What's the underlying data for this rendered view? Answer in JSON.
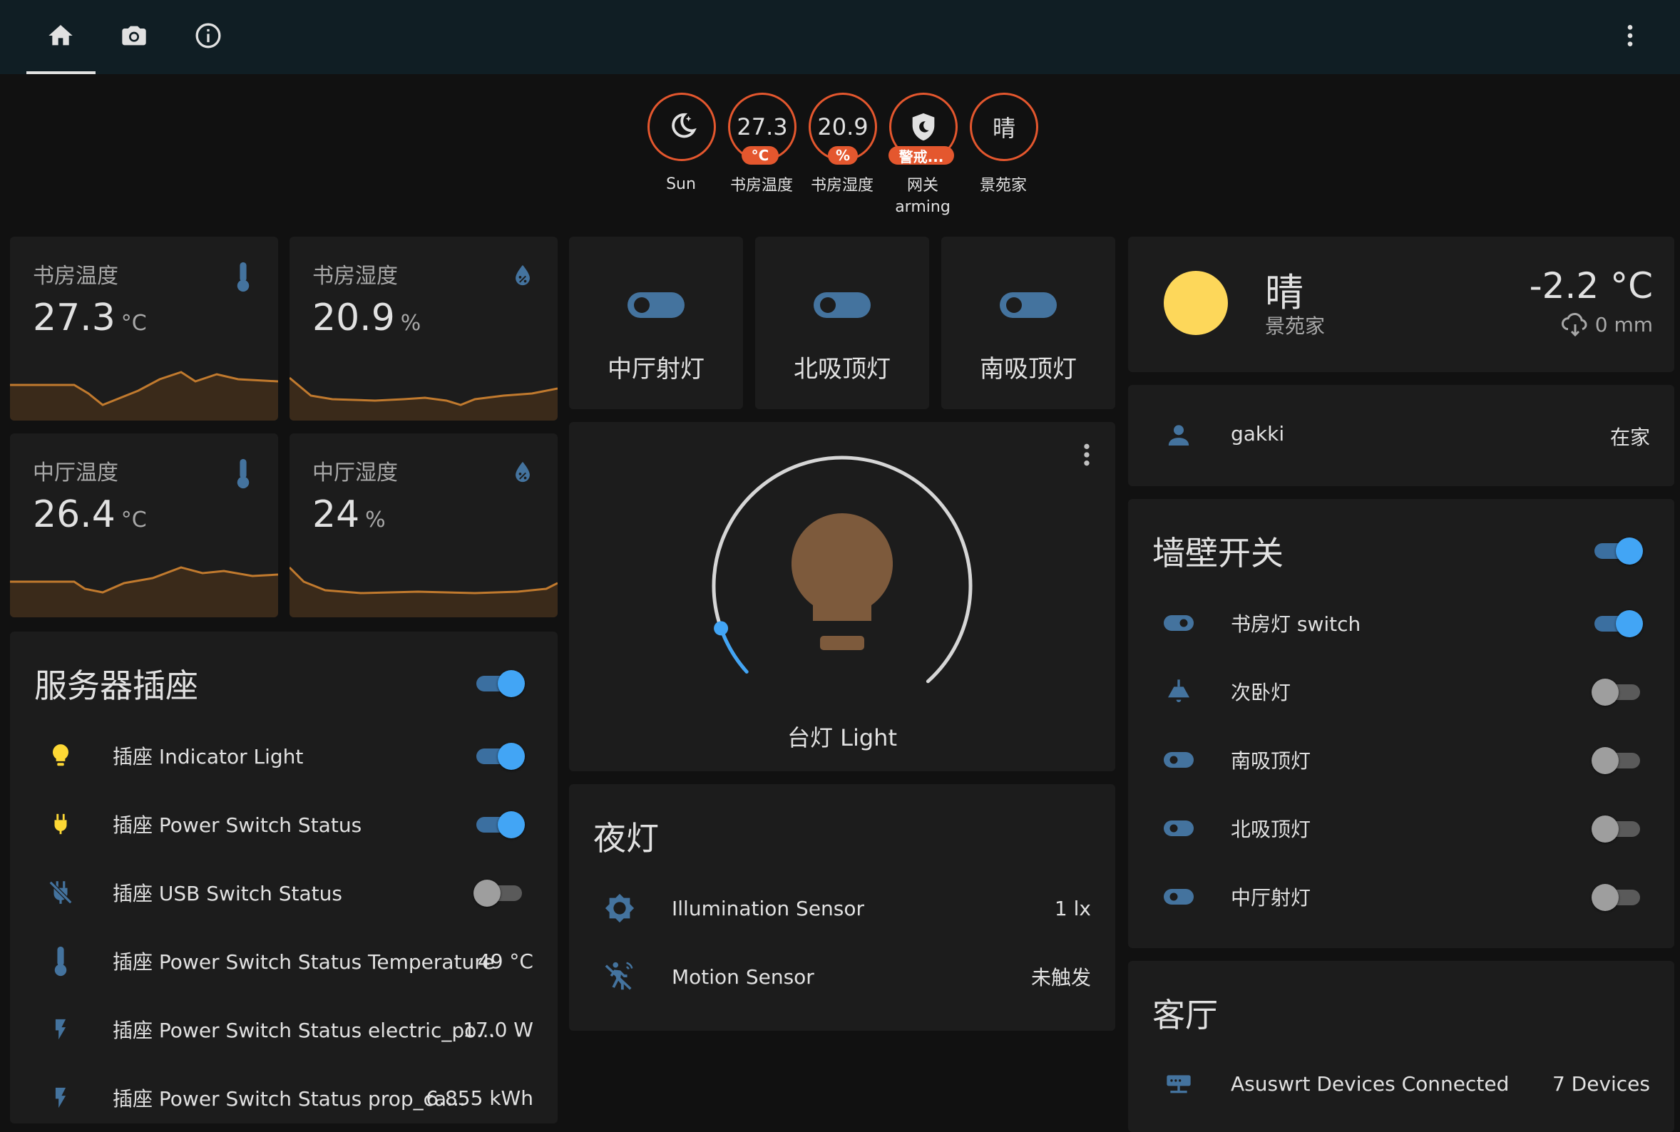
{
  "topbar": {
    "tabs": [
      {
        "icon": "home-icon",
        "active": true
      },
      {
        "icon": "camera-icon",
        "active": false
      },
      {
        "icon": "info-icon",
        "active": false
      }
    ],
    "menu_icon": "more-vertical-icon"
  },
  "badges": [
    {
      "icon": "weather-night-icon",
      "label": "Sun"
    },
    {
      "value": "27.3",
      "unit": "°C",
      "label": "书房温度"
    },
    {
      "value": "20.9",
      "unit": "%",
      "label": "书房湿度"
    },
    {
      "icon": "shield-moon-icon",
      "unit": "警戒...",
      "label": "网关",
      "label2": "arming"
    },
    {
      "value": "晴",
      "label": "景苑家"
    }
  ],
  "sensors": [
    {
      "name": "书房温度",
      "value": "27.3",
      "unit": "°C",
      "icon": "thermometer-icon"
    },
    {
      "name": "书房湿度",
      "value": "20.9",
      "unit": "%",
      "icon": "water-percent-icon"
    },
    {
      "name": "中厅温度",
      "value": "26.4",
      "unit": "°C",
      "icon": "thermometer-icon"
    },
    {
      "name": "中厅湿度",
      "value": "24",
      "unit": "%",
      "icon": "water-percent-icon"
    }
  ],
  "toggle_tiles": [
    {
      "label": "中厅射灯"
    },
    {
      "label": "北吸顶灯"
    },
    {
      "label": "南吸顶灯"
    }
  ],
  "light_card": {
    "name": "台灯 Light",
    "brightness_fraction": 0.04
  },
  "night_light": {
    "title": "夜灯",
    "rows": [
      {
        "icon": "brightness-icon",
        "label": "Illumination Sensor",
        "value": "1 lx"
      },
      {
        "icon": "motion-sensor-off-icon",
        "label": "Motion Sensor",
        "value": "未触发"
      }
    ]
  },
  "server_plug": {
    "title": "服务器插座",
    "header_toggle": true,
    "rows": [
      {
        "icon": "lightbulb-icon",
        "label": "插座 Indicator Light",
        "toggle": true,
        "icon_color": "#fdd835"
      },
      {
        "icon": "power-plug-icon",
        "label": "插座 Power Switch Status",
        "toggle": true,
        "icon_color": "#fdd835"
      },
      {
        "icon": "power-plug-off-icon",
        "label": "插座 USB Switch Status",
        "toggle": false,
        "icon_color": "#44739e"
      },
      {
        "icon": "thermometer-icon",
        "label": "插座 Power Switch Status Temperature",
        "value": "49 °C",
        "icon_color": "#44739e"
      },
      {
        "icon": "flash-icon",
        "label": "插座 Power Switch Status electric_po...",
        "value": "17.0 W",
        "icon_color": "#44739e"
      },
      {
        "icon": "flash-icon",
        "label": "插座 Power Switch Status prop_ca...",
        "value": "6.855 kWh",
        "icon_color": "#44739e"
      }
    ]
  },
  "weather": {
    "condition": "晴",
    "location": "景苑家",
    "temperature": "-2.2 °C",
    "precipitation": "0 mm"
  },
  "person": {
    "name": "gakki",
    "state": "在家"
  },
  "wall_switches": {
    "title": "墙壁开关",
    "header_toggle": true,
    "rows": [
      {
        "icon": "toggle-switch-icon",
        "label": "书房灯 switch",
        "toggle": true
      },
      {
        "icon": "ceiling-light-icon",
        "label": "次卧灯",
        "toggle": false
      },
      {
        "icon": "toggle-switch-icon",
        "label": "南吸顶灯",
        "toggle": false
      },
      {
        "icon": "toggle-switch-icon",
        "label": "北吸顶灯",
        "toggle": false
      },
      {
        "icon": "toggle-switch-icon",
        "label": "中厅射灯",
        "toggle": false
      }
    ]
  },
  "living_room": {
    "title": "客厅",
    "rows": [
      {
        "icon": "router-icon",
        "label": "Asuswrt Devices Connected",
        "value": "7 Devices"
      }
    ]
  },
  "colors": {
    "accent": "#42a5f5",
    "badge_border": "#e4572e",
    "icon_blue": "#44739e",
    "graph": "#c17a2e",
    "sun": "#fdd75a",
    "bulb": "#7d5a3c"
  }
}
